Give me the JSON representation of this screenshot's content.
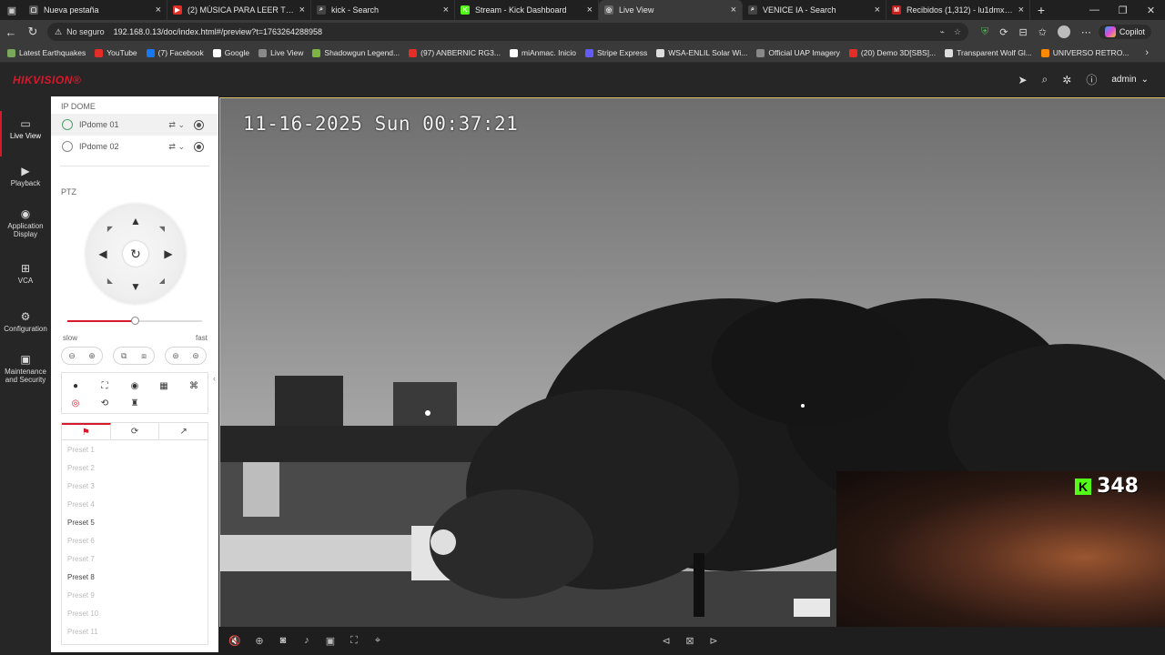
{
  "browser": {
    "tabs": [
      {
        "title": "Nueva pestaña",
        "color": "#555555",
        "glyph": "▢"
      },
      {
        "title": "(2) MÚSICA PARA LEER TERROR Y",
        "color": "#e52d27",
        "glyph": "▶"
      },
      {
        "title": "kick - Search",
        "color": "#444444",
        "glyph": "⌕"
      },
      {
        "title": "Stream - Kick Dashboard",
        "color": "#53fc18",
        "glyph": "K"
      },
      {
        "title": "Live View",
        "color": "#666666",
        "glyph": "◎"
      },
      {
        "title": "VENICE IA - Search",
        "color": "#444444",
        "glyph": "⌕"
      },
      {
        "title": "Recibidos (1,312) - lu1dmx.arg@",
        "color": "#c5221f",
        "glyph": "M"
      }
    ],
    "active_tab_index": 4,
    "security_label": "No seguro",
    "url": "192.168.0.13/doc/index.html#/preview?t=1763264288958",
    "copilot_label": "Copilot",
    "bookmarks": [
      {
        "label": "Latest Earthquakes",
        "color": "#7aa85a"
      },
      {
        "label": "YouTube",
        "color": "#e52d27"
      },
      {
        "label": "(7) Facebook",
        "color": "#1877f2"
      },
      {
        "label": "Google",
        "color": "#ffffff"
      },
      {
        "label": "Live View",
        "color": "#888888"
      },
      {
        "label": "Shadowgun Legend...",
        "color": "#7cb342"
      },
      {
        "label": "(97) ANBERNIC RG3...",
        "color": "#e52d27"
      },
      {
        "label": "miAnmac. Inicio",
        "color": "#ffffff"
      },
      {
        "label": "Stripe Express",
        "color": "#635bff"
      },
      {
        "label": "WSA-ENLIL Solar Wi...",
        "color": "#dddddd"
      },
      {
        "label": "Official UAP Imagery",
        "color": "#888888"
      },
      {
        "label": "(20) Demo 3D[SBS]...",
        "color": "#e52d27"
      },
      {
        "label": "Transparent Wolf Gl...",
        "color": "#dddddd"
      },
      {
        "label": "UNIVERSO RETRO...",
        "color": "#ff8a00"
      }
    ]
  },
  "app": {
    "logo": "HIKVISION®",
    "user": "admin",
    "nav": [
      {
        "label": "Live View",
        "icon": "▭"
      },
      {
        "label": "Playback",
        "icon": "▶"
      },
      {
        "label": "Application Display",
        "icon": "◉"
      },
      {
        "label": "VCA",
        "icon": "⊞"
      },
      {
        "label": "Configuration",
        "icon": "⚙"
      },
      {
        "label": "Maintenance and Security",
        "icon": "▣"
      }
    ],
    "device_group": "IP DOME",
    "cameras": [
      {
        "name": "IPdome 01"
      },
      {
        "name": "IPdome 02"
      }
    ],
    "ptz_title": "PTZ",
    "speed": {
      "slow": "slow",
      "fast": "fast",
      "value": 0.5
    },
    "presets": [
      "Preset 1",
      "Preset 2",
      "Preset 3",
      "Preset 4",
      "Preset 5",
      "Preset 6",
      "Preset 7",
      "Preset 8",
      "Preset 9",
      "Preset 10",
      "Preset 11"
    ],
    "presets_set": [
      5,
      8
    ]
  },
  "video": {
    "osd_timestamp": "11-16-2025 Sun 00:37:21",
    "kick_viewers": "348"
  }
}
